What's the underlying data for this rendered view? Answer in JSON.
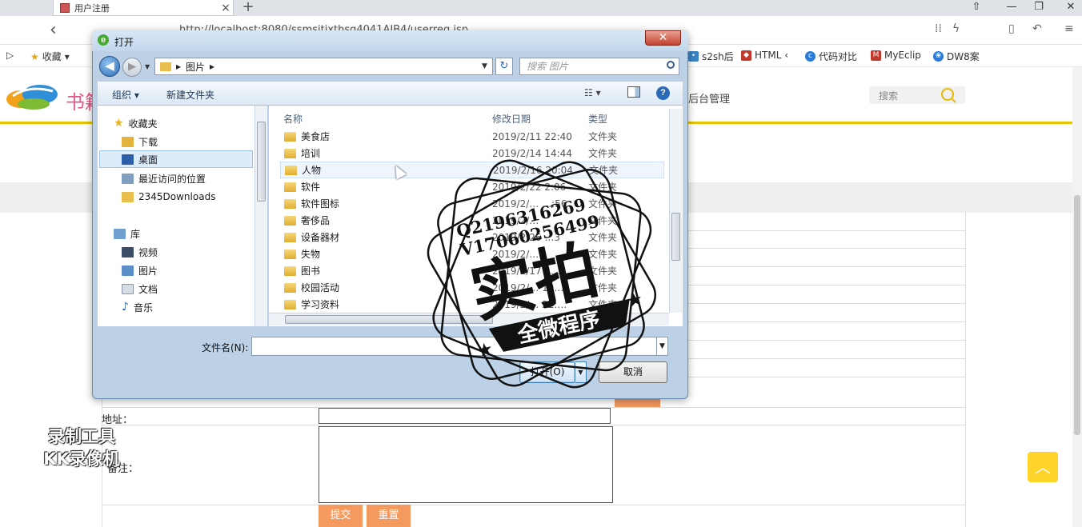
{
  "browser": {
    "tab_title": "用户注册",
    "tab_close": "×",
    "new_tab": "+",
    "url": "http://localhost:8080/ssmsitixthsg4041AIB4/userreg.jsp",
    "bookmarks_label": "收藏",
    "bookmarks": [
      {
        "label": "s2sh后",
        "color": "#3b82c4"
      },
      {
        "label": "HTML",
        "color": "#c0392b"
      },
      {
        "label": "代码对比",
        "color": "#2a7ad6"
      },
      {
        "label": "MyEclip",
        "color": "#c0392b"
      },
      {
        "label": "DW8案",
        "color": "#2a7ad6"
      }
    ],
    "window_controls": [
      "⇧",
      "—",
      "❐",
      "✕"
    ]
  },
  "site": {
    "name": "书籍",
    "nav_admin": "后台管理",
    "search_placeholder": "搜索",
    "form": {
      "address_label": "地址：",
      "remark_label": "备注：",
      "submit_label": "提交",
      "reset_label": "重置"
    },
    "scroll_top_icon": "︿"
  },
  "dialog": {
    "title": "打开",
    "close": "✕",
    "path_segments": [
      "▸",
      "图片",
      "▸"
    ],
    "search_placeholder": "搜索 图片",
    "toolbar": {
      "organize": "组织 ▾",
      "new_folder": "新建文件夹",
      "view": "☷ ▾",
      "help": "?"
    },
    "nav": {
      "favorites": "收藏夹",
      "downloads": "下载",
      "desktop": "桌面",
      "recent": "最近访问的位置",
      "downloads2345": "2345Downloads",
      "library": "库",
      "videos": "视频",
      "pictures": "图片",
      "documents": "文档",
      "music": "音乐"
    },
    "columns": {
      "name": "名称",
      "date": "修改日期",
      "type": "类型"
    },
    "files": [
      {
        "name": "美食店",
        "date": "2019/2/11 22:40",
        "type": "文件夹"
      },
      {
        "name": "培训",
        "date": "2019/2/14 14:44",
        "type": "文件夹"
      },
      {
        "name": "人物",
        "date": "2019/2/16 20:04",
        "type": "文件夹"
      },
      {
        "name": "软件",
        "date": "2019/2/22 2:06",
        "type": "文件夹"
      },
      {
        "name": "软件图标",
        "date": "2019/2/… …:56",
        "type": "文件夹"
      },
      {
        "name": "奢侈品",
        "date": "2019/2/…",
        "type": "文件夹"
      },
      {
        "name": "设备器材",
        "date": "2019/2/26 …3",
        "type": "文件夹"
      },
      {
        "name": "失物",
        "date": "2019/2/…1",
        "type": "文件夹"
      },
      {
        "name": "图书",
        "date": "2019/2/17 2…",
        "type": "文件夹"
      },
      {
        "name": "校园活动",
        "date": "2019/2/… 19…",
        "type": "文件夹"
      },
      {
        "name": "学习资料",
        "date": "2019/2/… 22:…",
        "type": "文件夹"
      }
    ],
    "filename_label": "文件名(N):",
    "open_label": "打开(O)",
    "cancel_label": "取消"
  },
  "overlay": {
    "kk_line1": "录制工具",
    "kk_line2": "KK录像机",
    "stamp_q": "Q2196316269",
    "stamp_v": "V17060256499",
    "stamp_main": "实拍",
    "stamp_banner": "全微程序"
  }
}
